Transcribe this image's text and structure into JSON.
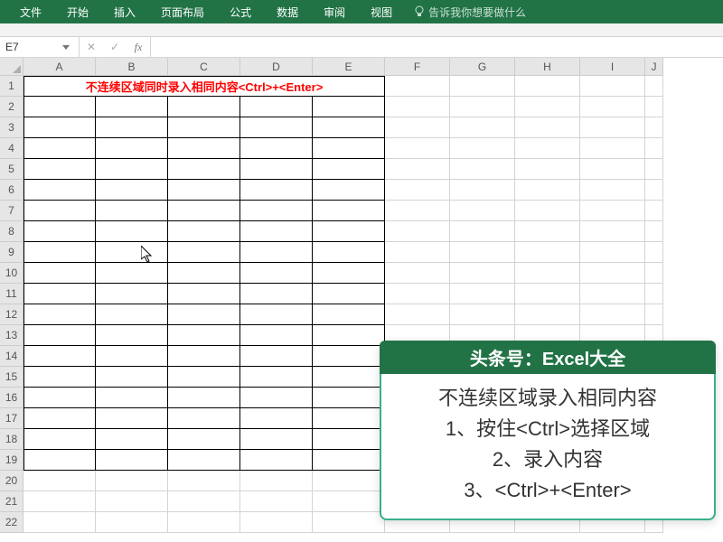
{
  "ribbon": {
    "tabs": [
      "文件",
      "开始",
      "插入",
      "页面布局",
      "公式",
      "数据",
      "审阅",
      "视图"
    ],
    "tellMe": "告诉我你想要做什么"
  },
  "nameBox": {
    "value": "E7"
  },
  "fxBar": {
    "cancel": "✕",
    "confirm": "✓",
    "fx": "fx",
    "formula": ""
  },
  "columns": [
    "A",
    "B",
    "C",
    "D",
    "E",
    "F",
    "G",
    "H",
    "I",
    "J"
  ],
  "rowCount": 22,
  "mergedTitle": "不连续区域同时录入相同内容<Ctrl>+<Enter>",
  "callout": {
    "header": "头条号：Excel大全",
    "lines": [
      "不连续区域录入相同内容",
      "1、按住<Ctrl>选择区域",
      "2、录入内容",
      "3、<Ctrl>+<Enter>"
    ]
  }
}
